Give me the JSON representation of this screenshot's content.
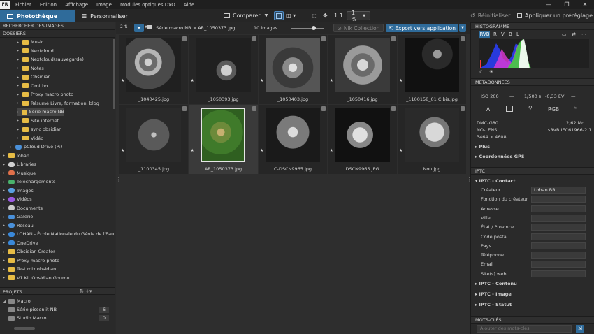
{
  "menubar": {
    "logo": "FR",
    "items": [
      "Fichier",
      "Edition",
      "Affichage",
      "Image",
      "Modules optiques DxO",
      "Aide"
    ],
    "window_buttons": [
      "—",
      "❐",
      "✕"
    ]
  },
  "toolbar": {
    "tab_phototheque": "Photothèque",
    "tab_personnaliser": "Personnaliser",
    "compare": "Comparer",
    "ratio": "1:1",
    "zoom": "1 %",
    "reinitialiser": "Réinitialiser",
    "preset": "Appliquer un préréglage"
  },
  "left": {
    "search_header": "RECHERCHER DES IMAGES",
    "folders_header": "DOSSIERS",
    "folders": [
      {
        "label": "Music",
        "type": "folder",
        "indent": 2
      },
      {
        "label": "Nextcloud",
        "type": "folder",
        "indent": 2
      },
      {
        "label": "Nextcloud(sauvegarde)",
        "type": "folder",
        "indent": 2
      },
      {
        "label": "Notes",
        "type": "folder",
        "indent": 2
      },
      {
        "label": "Obsidian",
        "type": "folder",
        "indent": 2
      },
      {
        "label": "Ornitho",
        "type": "folder",
        "indent": 2
      },
      {
        "label": "Proxy macro photo",
        "type": "folder",
        "indent": 2
      },
      {
        "label": "Résumé Livre, formation, blog",
        "type": "folder",
        "indent": 2
      },
      {
        "label": "Série macro NB",
        "type": "folder",
        "indent": 2,
        "selected": true
      },
      {
        "label": "Site internet",
        "type": "folder",
        "indent": 2
      },
      {
        "label": "sync obsidian",
        "type": "folder",
        "indent": 2
      },
      {
        "label": "Vidéo",
        "type": "folder",
        "indent": 2
      },
      {
        "label": "pCloud Drive (P:)",
        "type": "drive",
        "indent": 1
      },
      {
        "label": "lohan",
        "type": "folder",
        "indent": 0
      },
      {
        "label": "Libraries",
        "type": "lib",
        "indent": 0
      },
      {
        "label": "Musique",
        "type": "music",
        "indent": 0
      },
      {
        "label": "Téléchargements",
        "type": "download",
        "indent": 0
      },
      {
        "label": "Images",
        "type": "images",
        "indent": 0
      },
      {
        "label": "Vidéos",
        "type": "videos",
        "indent": 0
      },
      {
        "label": "Documents",
        "type": "docs",
        "indent": 0
      },
      {
        "label": "Galerie",
        "type": "gallery",
        "indent": 0
      },
      {
        "label": "Réseau",
        "type": "network",
        "indent": 0
      },
      {
        "label": "LOHAN - École Nationale du Génie de l'Eau",
        "type": "cloud",
        "indent": 0
      },
      {
        "label": "OneDrive",
        "type": "cloud",
        "indent": 0
      },
      {
        "label": "Obsidian Creator",
        "type": "folder",
        "indent": 0
      },
      {
        "label": "Proxy macro photo",
        "type": "folder",
        "indent": 0
      },
      {
        "label": "Test mix obsidian",
        "type": "folder",
        "indent": 0
      },
      {
        "label": "V1 Kit Obsidian Gourou",
        "type": "folder",
        "indent": 0
      }
    ],
    "projects_header": "PROJETS",
    "projects": [
      {
        "label": "Macro",
        "count": ""
      },
      {
        "label": "Série pissenlit NB",
        "count": "6"
      },
      {
        "label": "Studio Macro",
        "count": "0"
      }
    ]
  },
  "center": {
    "sort_label": "2",
    "path": "Série macro NB  >  AR_1050373.jpg",
    "count": "10 images",
    "nik": "Nik Collection",
    "export": "Export vers application",
    "thumbnails": [
      {
        "name": "_1040425.jpg"
      },
      {
        "name": "_1050393.jpg"
      },
      {
        "name": "_1050403.jpg"
      },
      {
        "name": "_1050416.jpg"
      },
      {
        "name": "_1100158_01 C bis.jpg"
      },
      {
        "name": "_1100345.jpg"
      },
      {
        "name": "AR_1050373.jpg",
        "selected": true
      },
      {
        "name": "C-DSCN9965.jpg"
      },
      {
        "name": "DSCN9965.JPG"
      },
      {
        "name": "Non.jpg"
      }
    ]
  },
  "right": {
    "histogram_header": "HISTOGRAMME",
    "hist_tabs": [
      "RVB",
      "R",
      "V",
      "B",
      "L"
    ],
    "meta_header": "MÉTADONNÉES",
    "exposure": [
      "ISO 200",
      "—",
      "1/500 s",
      "-0,33 EV"
    ],
    "modes": [
      "A",
      "RGB"
    ],
    "camera": "DMC-G80",
    "size": "2,62 Mo",
    "lens": "NO-LENS",
    "colorspace": "sRVB IEC61966-2.1",
    "dims": "3464 × 4608",
    "plus": "Plus",
    "gps": "Coordonnées GPS",
    "iptc_header": "IPTC",
    "iptc_contact": "IPTC - Contact",
    "fields": [
      {
        "label": "Créateur",
        "value": "Lohan BR"
      },
      {
        "label": "Fonction du créateur",
        "value": ""
      },
      {
        "label": "Adresse",
        "value": ""
      },
      {
        "label": "Ville",
        "value": ""
      },
      {
        "label": "État / Province",
        "value": ""
      },
      {
        "label": "Code postal",
        "value": ""
      },
      {
        "label": "Pays",
        "value": ""
      },
      {
        "label": "Téléphone",
        "value": ""
      },
      {
        "label": "Email",
        "value": ""
      },
      {
        "label": "Site(s) web",
        "value": ""
      }
    ],
    "iptc_content": "IPTC - Contenu",
    "iptc_image": "IPTC - Image",
    "iptc_status": "IPTC - Statut",
    "keywords_header": "MOTS-CLÉS",
    "keywords_placeholder": "Ajouter des mots-clés"
  }
}
